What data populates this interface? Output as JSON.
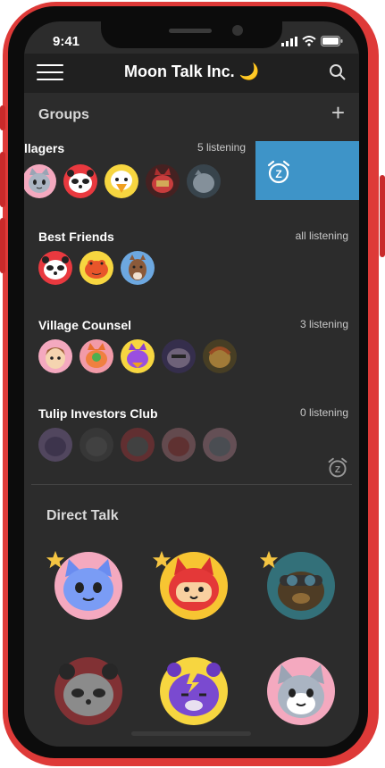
{
  "status": {
    "time": "9:41"
  },
  "header": {
    "title": "Moon Talk Inc. 🌙"
  },
  "groups_section": {
    "title": "Groups"
  },
  "groups": [
    {
      "name": "llagers",
      "status": "5 listening"
    },
    {
      "name": "Best Friends",
      "status": "all listening"
    },
    {
      "name": "Village Counsel",
      "status": "3 listening"
    },
    {
      "name": "Tulip Investors Club",
      "status": "0 listening"
    }
  ],
  "direct_section": {
    "title": "Direct Talk"
  },
  "colors": {
    "accent": "#3e94c8",
    "star": "#f5c542",
    "phone": "#de3a38"
  }
}
